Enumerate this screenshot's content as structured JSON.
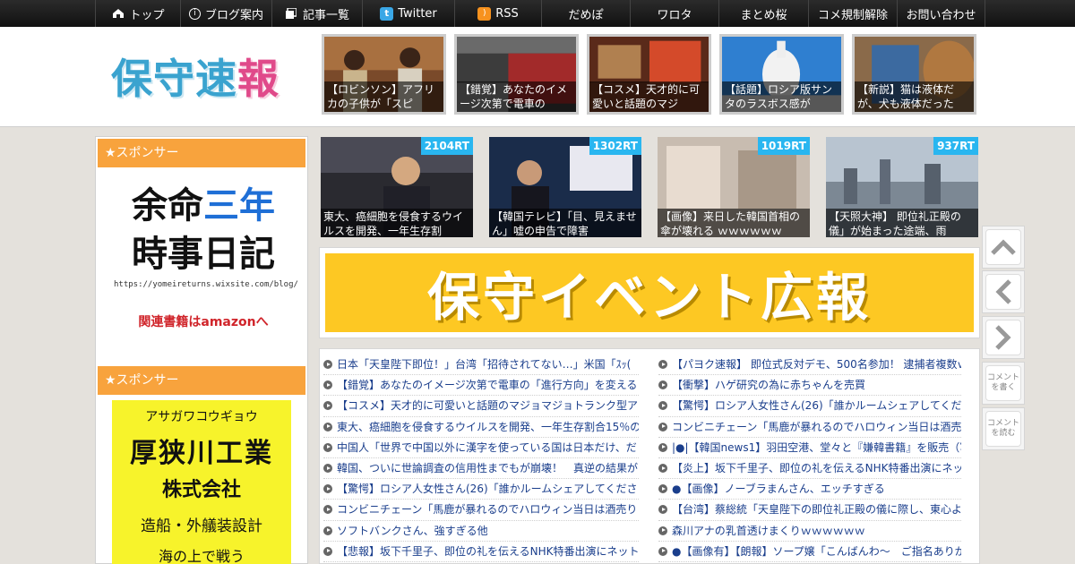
{
  "nav": {
    "items": [
      {
        "icon": "home-icon",
        "label": "トップ"
      },
      {
        "icon": "info-icon",
        "label": "ブログ案内"
      },
      {
        "icon": "list-icon",
        "label": "記事一覧"
      },
      {
        "icon": "twitter-icon",
        "label": "Twitter"
      },
      {
        "icon": "rss-icon",
        "label": "RSS"
      },
      {
        "icon": "",
        "label": "だめぽ"
      },
      {
        "icon": "",
        "label": "ワロタ"
      },
      {
        "icon": "",
        "label": "まとめ桜"
      },
      {
        "icon": "",
        "label": "コメ規制解除"
      },
      {
        "icon": "",
        "label": "お問い合わせ"
      }
    ]
  },
  "header": {
    "logo_blue": "保守速",
    "logo_pink": "報",
    "thumbs": [
      {
        "caption": "【ロビンソン】アフリカの子供が「スピ"
      },
      {
        "caption": "【錯覚】あなたのイメージ次第で電車の"
      },
      {
        "caption": "【コスメ】天才的に可愛いと話題のマジ"
      },
      {
        "caption": "【話題】ロシア版サンタのラスボス感が"
      },
      {
        "caption": "【新説】猫は液体だが、犬も液体だった"
      }
    ]
  },
  "sidebar": {
    "sponsor_label": "★スポンサー",
    "ad1": {
      "line1_black": "余命",
      "line1_blue": "三年",
      "line2": "時事日記",
      "url": "https://yomeireturns.wixsite.com/blog/",
      "link": "関連書籍はamazonへ"
    },
    "sponsor_label2": "★スポンサー",
    "ad2": {
      "kana": "アサガワコウギョウ",
      "name": "厚狭川工業",
      "kk": "株式会社",
      "desc": "造船・外艤装設計",
      "sub": "海の上で戦う"
    }
  },
  "rt_thumbs": [
    {
      "badge": "2104RT",
      "caption": "東大、癌細胞を侵食するウイルスを開発、一年生存割"
    },
    {
      "badge": "1302RT",
      "caption": "【韓国テレビ】「目、見えません」嘘の申告で障害"
    },
    {
      "badge": "1019RT",
      "caption": "【画像】来日した韓国首相の傘が壊れる ｗｗｗｗｗｗ"
    },
    {
      "badge": "937RT",
      "caption": "【天照大神】 即位礼正殿の儀」が始まった途端、雨"
    }
  ],
  "banner": {
    "text": "保守イベント広報"
  },
  "list": {
    "left": [
      "日本「天皇陛下即位！」台湾「招待されてない…」米国「ｽｯ(",
      "【錯覚】あなたのイメージ次第で電車の「進行方向」を変える",
      "【コスメ】天才的に可愛いと話題のマジョマジョトランク型ア",
      "東大、癌細胞を侵食するウイルスを開発、一年生存割合15％の",
      "中国人「世界で中国以外に漢字を使っている国は日本だけ、だ",
      "韓国、ついに世論調査の信用性までもが崩壊！　真逆の結果が",
      "【驚愕】ロシア人女性さん(26)「誰かルームシェアしてくださ",
      "コンビニチェーン「馬鹿が暴れるのでハロウィン当日は酒売り",
      "ソフトバンクさん、強すぎる他",
      "【悲報】坂下千里子、即位の礼を伝えるNHK特番出演にネット"
    ],
    "right": [
      "【パヨク速報】 即位式反対デモ、500名参加！ 逮捕者複数ｗｗ",
      "【衝撃】ハゲ研究の為に赤ちゃんを売買",
      "【驚愕】ロシア人女性さん(26)「誰かルームシェアしてくださ",
      "コンビニチェーン「馬鹿が暴れるのでハロウィン当日は酒売り",
      "|●|【韓国news1】羽田空港、堂々と『嫌韓書籍』を販売（写真）",
      "【炎上】坂下千里子、即位の礼を伝えるNHK特番出演にネット",
      "●【画像】ノーブラまんさん、エッチすぎる",
      "【台湾】蔡総統「天皇陛下の即位礼正殿の儀に際し、東心より",
      "森川アナの乳首透けまくりｗｗｗｗｗｗ",
      "●【画像有】【朗報】ソープ嬢「こんばんわ～　ご指名ありがと"
    ]
  },
  "float_buttons": {
    "top": "chevron-up-icon",
    "prev": "chevron-left-icon",
    "next": "chevron-right-icon",
    "write": "コメントを書く",
    "read": "コメントを読む"
  }
}
